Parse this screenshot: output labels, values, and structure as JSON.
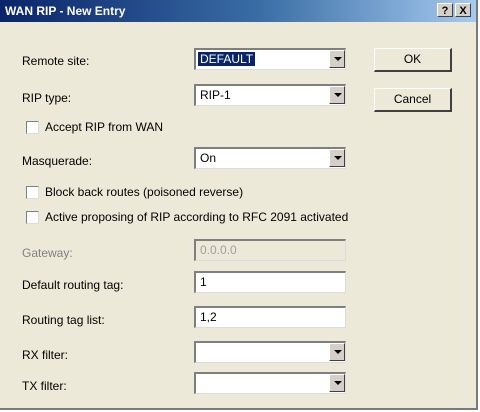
{
  "window": {
    "title": "WAN RIP - New Entry",
    "help_label": "?",
    "close_label": "X"
  },
  "fields": {
    "remote_site": {
      "label": "Remote site:",
      "value": "DEFAULT"
    },
    "rip_type": {
      "label": "RIP type:",
      "value": "RIP-1"
    },
    "accept_rip": {
      "label": "Accept RIP from WAN",
      "checked": false
    },
    "masquerade": {
      "label": "Masquerade:",
      "value": "On"
    },
    "block_back_routes": {
      "label": "Block back routes (poisoned reverse)",
      "checked": false
    },
    "active_proposing": {
      "label": "Active proposing of RIP according to RFC 2091 activated",
      "checked": false
    },
    "gateway": {
      "label": "Gateway:",
      "value": "0.0.0.0",
      "disabled": true
    },
    "default_routing_tag": {
      "label": "Default routing tag:",
      "value": "1"
    },
    "routing_tag_list": {
      "label": "Routing tag list:",
      "value": "1,2"
    },
    "rx_filter": {
      "label": "RX filter:",
      "value": ""
    },
    "tx_filter": {
      "label": "TX filter:",
      "value": ""
    }
  },
  "buttons": {
    "ok": "OK",
    "cancel": "Cancel"
  },
  "colors": {
    "titlebar_start": "#0a246a",
    "titlebar_end": "#a6caf0",
    "dialog_bg": "#ece9d8",
    "selection": "#0a246a"
  }
}
